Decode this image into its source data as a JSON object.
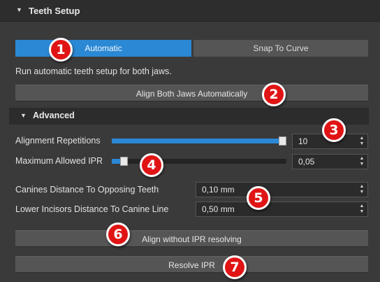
{
  "panel": {
    "title": "Teeth Setup"
  },
  "mode_toggle": {
    "automatic_label": "Automatic",
    "snap_label": "Snap To Curve",
    "selected": "Automatic"
  },
  "description": "Run automatic teeth setup for both jaws.",
  "align_both_label": "Align Both Jaws Automatically",
  "advanced": {
    "title": "Advanced",
    "alignment_repetitions": {
      "label": "Alignment Repetitions",
      "value": "10",
      "slider_fraction": 1.0
    },
    "max_ipr": {
      "label": "Maximum Allowed IPR",
      "value": "0,05",
      "slider_fraction": 0.05
    }
  },
  "canines_distance": {
    "label": "Canines Distance To Opposing Teeth",
    "value": "0,10 mm"
  },
  "lower_incisors_distance": {
    "label": "Lower Incisors Distance To Canine Line",
    "value": "0,50 mm"
  },
  "align_without_ipr_label": "Align without IPR resolving",
  "resolve_ipr_label": "Resolve IPR",
  "markers": [
    "1",
    "2",
    "3",
    "4",
    "5",
    "6",
    "7"
  ],
  "colors": {
    "accent": "#2b88d4",
    "marker": "#e01414",
    "panel_bg": "#3a3a3a",
    "button_bg": "#555555"
  }
}
